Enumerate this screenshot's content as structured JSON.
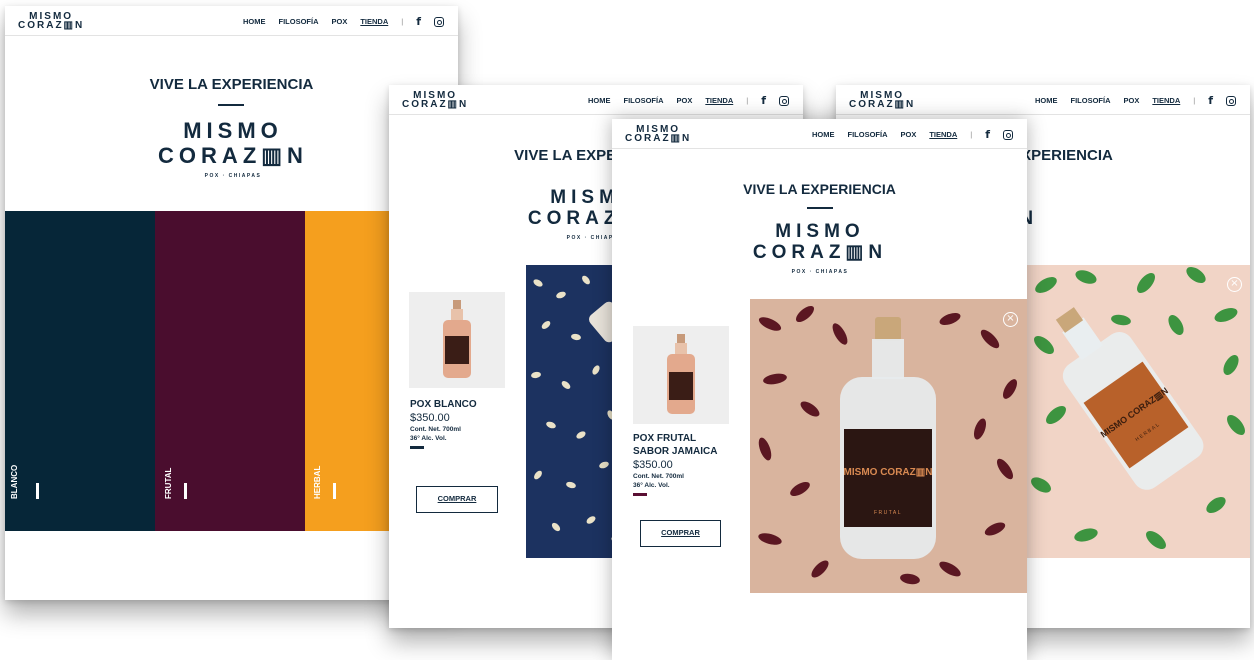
{
  "brand": {
    "line1": "MISMO",
    "line2": "CORAZ▥N",
    "sub": "POX · CHIAPAS"
  },
  "nav": {
    "home": "HOME",
    "filosofia": "FILOSOFÍA",
    "pox": "POX",
    "tienda": "TIENDA",
    "sep": "|",
    "fb": "f"
  },
  "hero": {
    "headline": "VIVE LA EXPERIENCIA"
  },
  "categories": [
    {
      "label": "BLANCO",
      "color": "#062638"
    },
    {
      "label": "FRUTAL",
      "color": "#4a0d2e"
    },
    {
      "label": "HERBAL",
      "color": "#f59f1e"
    }
  ],
  "product_blanco": {
    "name": "POX BLANCO",
    "price": "$350.00",
    "content": "Cont. Net. 700ml",
    "alcohol": "36° Alc. Vol.",
    "buy": "COMPRAR",
    "accent": "#132a3e"
  },
  "product_frutal": {
    "name_line1": "POX FRUTAL",
    "name_line2": "SABOR JAMAICA",
    "price": "$350.00",
    "content": "Cont. Net. 700ml",
    "alcohol": "36° Alc. Vol.",
    "buy": "COMPRAR",
    "accent": "#5a0f33",
    "label_brand": "MISMO CORAZ▥N",
    "label_variant": "FRUTAL"
  },
  "product_herbal": {
    "label_brand": "MISMO CORAZ▥N",
    "label_variant": "HERBAL"
  },
  "close_symbol": "×"
}
